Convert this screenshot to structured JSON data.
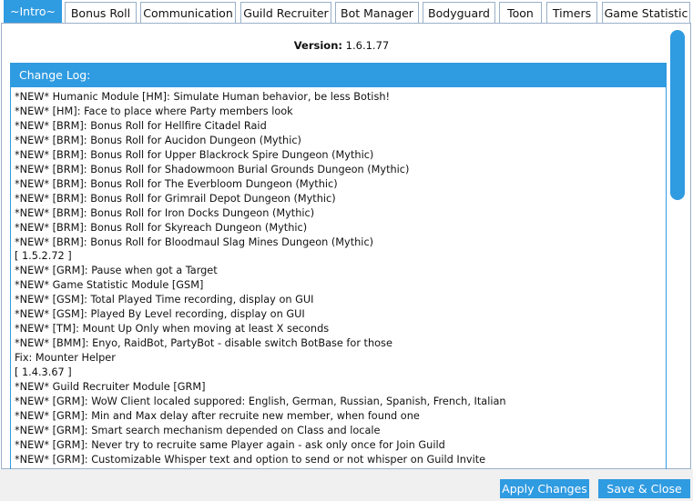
{
  "tabs": [
    {
      "label": "~Intro~",
      "active": true
    },
    {
      "label": "Bonus Roll",
      "active": false
    },
    {
      "label": "Communication",
      "active": false
    },
    {
      "label": "Guild Recruiter",
      "active": false
    },
    {
      "label": "Bot Manager",
      "active": false
    },
    {
      "label": "Bodyguard",
      "active": false
    },
    {
      "label": "Toon",
      "active": false
    },
    {
      "label": "Timers",
      "active": false
    },
    {
      "label": "Game Statistic",
      "active": false
    }
  ],
  "version": {
    "label": "Version:",
    "value": "1.6.1.77"
  },
  "changelog": {
    "title": "Change Log:",
    "lines": [
      "*NEW* Humanic Module [HM]: Simulate Human behavior, be less Botish!",
      "*NEW* [HM]: Face to place where Party members look",
      "*NEW* [BRM]: Bonus Roll for Hellfire Citadel Raid",
      "*NEW* [BRM]: Bonus Roll for Aucidon Dungeon (Mythic)",
      "*NEW* [BRM]: Bonus Roll for Upper Blackrock Spire Dungeon (Mythic)",
      "*NEW* [BRM]: Bonus Roll for Shadowmoon Burial Grounds Dungeon (Mythic)",
      "*NEW* [BRM]: Bonus Roll for The Everbloom Dungeon (Mythic)",
      "*NEW* [BRM]: Bonus Roll for Grimrail Depot Dungeon (Mythic)",
      "*NEW* [BRM]: Bonus Roll for Iron Docks Dungeon (Mythic)",
      "*NEW* [BRM]: Bonus Roll for Skyreach Dungeon (Mythic)",
      "*NEW* [BRM]: Bonus Roll for Bloodmaul Slag Mines Dungeon (Mythic)",
      "[ 1.5.2.72 ]",
      "*NEW* [GRM]: Pause when got a Target",
      "*NEW* Game Statistic Module [GSM]",
      "*NEW* [GSM]: Total Played Time recording, display on GUI",
      "*NEW* [GSM]: Played By Level recording, display on GUI",
      "*NEW* [TM]: Mount Up Only when moving at least X seconds",
      "*NEW* [BMM]: Enyo, RaidBot, PartyBot  - disable switch BotBase for those",
      "Fix: Mounter Helper",
      "[ 1.4.3.67 ]",
      "*NEW* Guild Recruiter Module [GRM]",
      "*NEW* [GRM]: WoW Client localed suppored: English, German, Russian, Spanish, French, Italian",
      "*NEW* [GRM]: Min and Max delay after recruite new member, when found one",
      "*NEW* [GRM]: Smart search mechanism depended on Class and locale",
      "*NEW* [GRM]: Never try to recruite same Player again - ask only once for Join Guild",
      "*NEW* [GRM]: Customizable Whisper text and option to send or not whisper on Guild Invite"
    ]
  },
  "footer": {
    "apply_label": "Apply Changes",
    "save_label": "Save & Close"
  },
  "colors": {
    "accent": "#2f9be1",
    "border": "#9ab0c8",
    "footer_bg": "#f0f0f0"
  }
}
